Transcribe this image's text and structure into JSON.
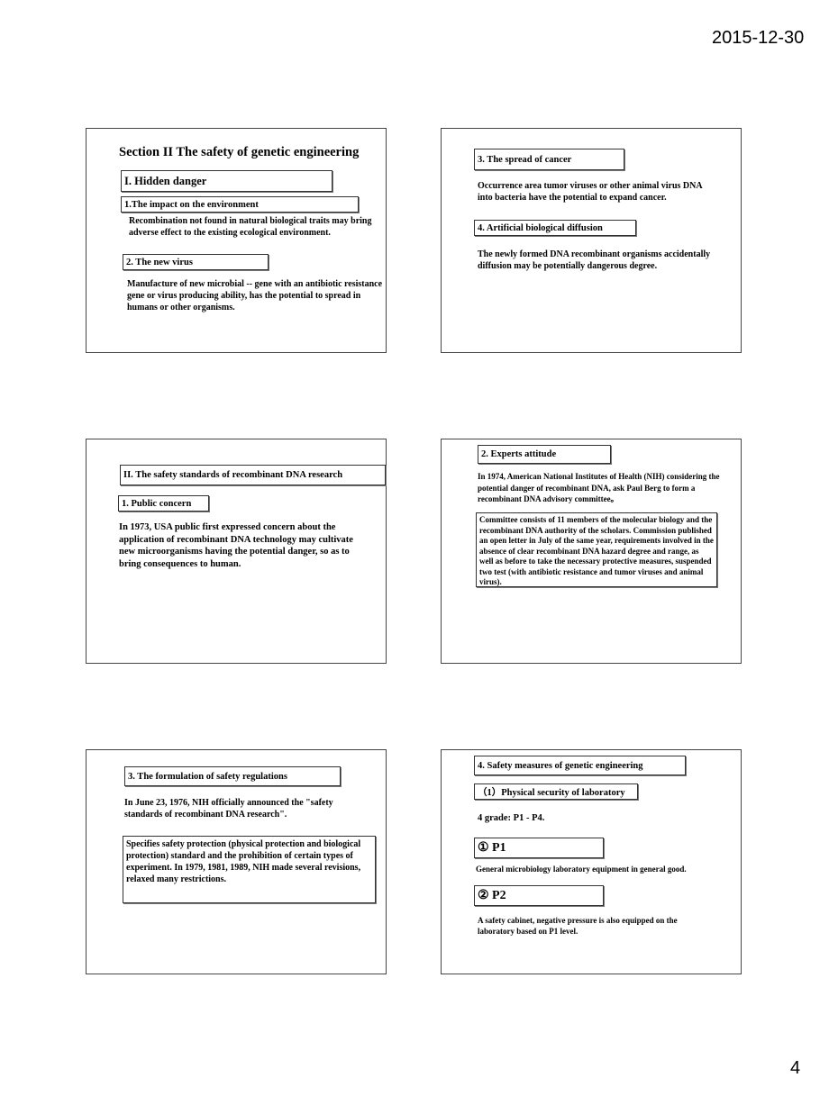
{
  "header": {
    "date": "2015-12-30"
  },
  "footer": {
    "page_number": "4"
  },
  "slides": [
    {
      "title": "Section II The safety of genetic engineering",
      "heading": "I. Hidden danger",
      "sub1": "1.The impact on the environment",
      "text1": "Recombination not found in natural biological traits may bring adverse effect to the existing ecological environment.",
      "sub2": "2. The new virus",
      "text2": "Manufacture of new microbial -- gene with an antibiotic resistance gene or virus producing ability, has the potential to spread in humans or other organisms."
    },
    {
      "sub1": "3. The spread of cancer",
      "text1": "Occurrence area tumor viruses or other animal virus DNA into bacteria have the potential to expand cancer.",
      "sub2": "4. Artificial biological diffusion",
      "text2": "The newly formed DNA recombinant organisms accidentally diffusion may be potentially dangerous degree."
    },
    {
      "heading": "II. The safety standards of recombinant DNA research",
      "sub1": "1. Public concern",
      "text1": "In 1973, USA public first expressed concern about the application of recombinant DNA technology may cultivate new microorganisms having the potential danger, so as to bring consequences to human."
    },
    {
      "sub1": "2. Experts attitude",
      "text1": "In 1974,  American National Institutes of Health (NIH) considering the potential danger of recombinant DNA,  ask Paul Berg to form a recombinant DNA advisory committee。",
      "text2": "Committee consists of 11 members of the molecular biology and the recombinant DNA authority of the scholars. Commission published an open letter in July of the same year, requirements involved in the absence of clear recombinant DNA hazard degree and range, as well as before to take the necessary protective measures, suspended two test (with antibiotic resistance and tumor viruses and animal virus)."
    },
    {
      "sub1": "3. The formulation of safety regulations",
      "text1": "In June 23, 1976, NIH officially announced the \"safety standards of recombinant DNA research\".",
      "text2": "Specifies safety protection (physical protection and biological protection) standard and the prohibition of certain types of experiment. In 1979, 1981, 1989, NIH made several revisions, relaxed many restrictions."
    },
    {
      "sub1": "4. Safety measures of genetic engineering",
      "sub2": "（1）Physical security of laboratory",
      "text1": "4 grade: P1 - P4.",
      "p1": "①  P1",
      "p1_text": "General microbiology laboratory equipment in general good.",
      "p2": "②  P2",
      "p2_text": "A safety cabinet, negative pressure is also equipped on the laboratory based on P1 level."
    }
  ]
}
